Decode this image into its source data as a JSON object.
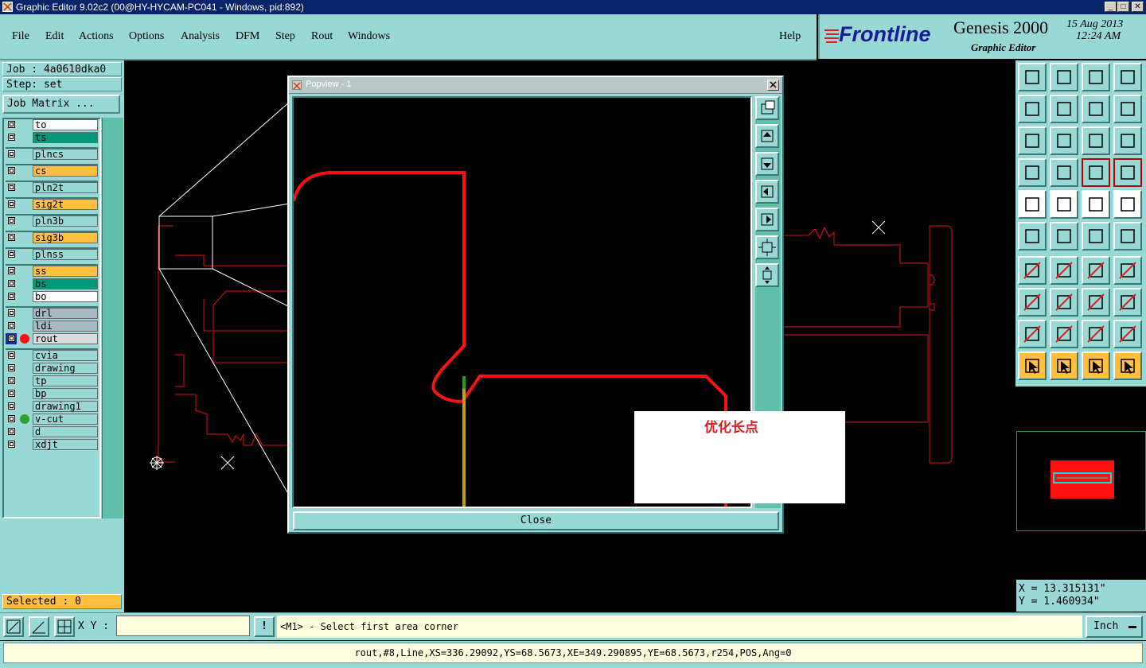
{
  "window": {
    "title": "Graphic Editor 9.02c2 (00@HY-HYCAM-PC041 - Windows, pid:892)",
    "buttons": [
      "_",
      "□",
      "✕"
    ]
  },
  "menu": {
    "items": [
      "File",
      "Edit",
      "Actions",
      "Options",
      "Analysis",
      "DFM",
      "Step",
      "Rout",
      "Windows"
    ],
    "help": "Help"
  },
  "brand": {
    "logo": "Frontline",
    "product": "Genesis 2000",
    "subtitle": "Graphic Editor",
    "date": "15 Aug 2013",
    "time": "12:24 AM"
  },
  "job": {
    "job_label": "Job : 4a0610dka0",
    "step_label": "Step: set",
    "matrix_button": "Job Matrix ..."
  },
  "layers": [
    {
      "name": "to",
      "color": "#ffffff"
    },
    {
      "name": "ts",
      "color": "#009878"
    },
    {
      "name": "plncs",
      "color": "#99d8d4"
    },
    {
      "name": "cs",
      "color": "#ffc040"
    },
    {
      "name": "pln2t",
      "color": "#99d8d4"
    },
    {
      "name": "sig2t",
      "color": "#ffc040"
    },
    {
      "name": "pln3b",
      "color": "#99d8d4"
    },
    {
      "name": "sig3b",
      "color": "#ffc040"
    },
    {
      "name": "plnss",
      "color": "#99d8d4"
    },
    {
      "name": "ss",
      "color": "#ffc040"
    },
    {
      "name": "bs",
      "color": "#009878"
    },
    {
      "name": "bo",
      "color": "#ffffff"
    },
    {
      "name": "drl",
      "color": "#a8b8c0"
    },
    {
      "name": "ldi",
      "color": "#a8b8c0"
    },
    {
      "name": "rout",
      "color": "#dcdcdc"
    },
    {
      "name": "cvia",
      "color": "#99d8d4"
    },
    {
      "name": "drawing",
      "color": "#99d8d4"
    },
    {
      "name": "tp",
      "color": "#99d8d4"
    },
    {
      "name": "bp",
      "color": "#99d8d4"
    },
    {
      "name": "drawing1",
      "color": "#99d8d4"
    },
    {
      "name": "v-cut",
      "color": "#99d8d4"
    },
    {
      "name": "d",
      "color": "#99d8d4"
    },
    {
      "name": "xdjt",
      "color": "#99d8d4"
    }
  ],
  "selected_label": "Selected : 0",
  "popview": {
    "title": "Popview - 1",
    "close_label": "Close"
  },
  "annotation_text": "优化长点",
  "coords": {
    "x": "X = 13.315131\"",
    "y": "Y = 1.460934\""
  },
  "bottom": {
    "xy_label": "X Y :",
    "xy_value": "",
    "excl": "!",
    "prompt": "<M1> - Select first area corner",
    "unit": "Inch"
  },
  "status": "rout,#8,Line,XS=336.29092,YS=68.5673,XE=349.290895,YE=68.5673,r254,POS,Ang=0",
  "colors": {
    "panel": "#99d8d4",
    "route": "#ff0000",
    "highlight": "#ffc040",
    "titlebar": "#0a246a"
  }
}
